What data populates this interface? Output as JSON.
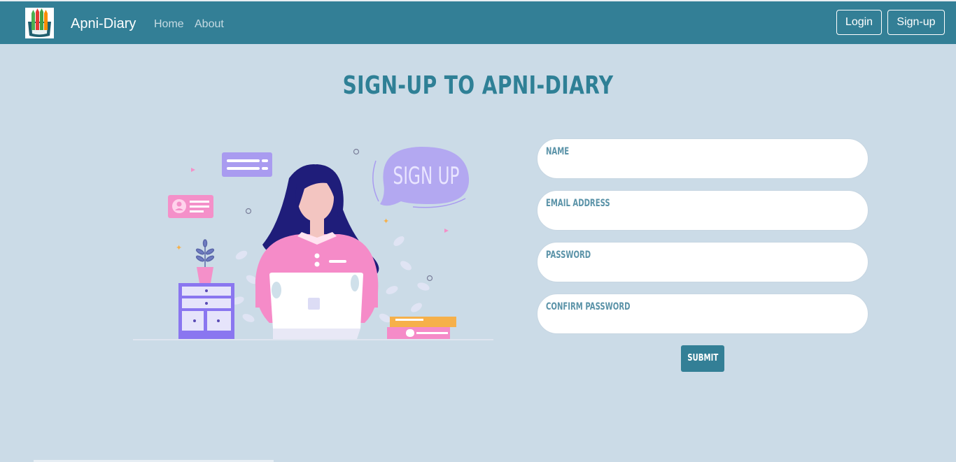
{
  "navbar": {
    "brand": "Apni-Diary",
    "links": [
      {
        "label": "Home"
      },
      {
        "label": "About"
      }
    ],
    "login_label": "Login",
    "signup_label": "Sign-up",
    "color": "#337f96"
  },
  "main": {
    "title": "SIGN-UP TO APNI-DIARY",
    "illustration": {
      "bubble_text": "SIGN UP"
    },
    "form": {
      "fields": [
        {
          "label": "NAME",
          "value": ""
        },
        {
          "label": "EMAIL ADDRESS",
          "value": ""
        },
        {
          "label": "PASSWORD",
          "value": ""
        },
        {
          "label": "CONFIRM PASSWORD",
          "value": ""
        }
      ],
      "submit_label": "SUBMIT"
    }
  },
  "colors": {
    "background": "#cbdbe7",
    "accent": "#337f96"
  }
}
